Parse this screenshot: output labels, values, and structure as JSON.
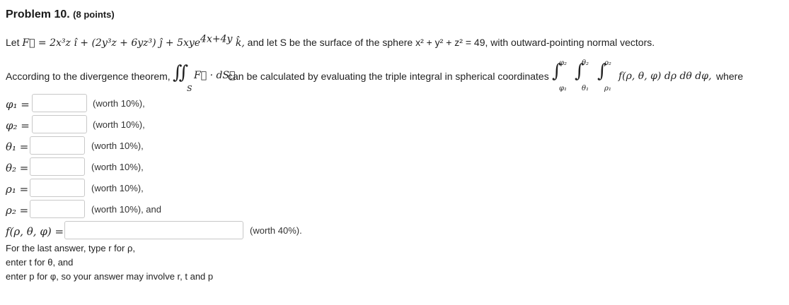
{
  "problem": {
    "title": "Problem 10.",
    "points": "(8 points)"
  },
  "statement": {
    "lead": "Let ",
    "field": "F⃗ = 2x³z î + (2y³z + 6yz³) ĵ + 5xye",
    "field_exp": "4x+4y",
    "field_tail": " k̂,",
    "surface": " and let S be the surface of the sphere x² + y² + z² = 49, with outward-pointing normal vectors."
  },
  "divergence": {
    "intro": "According to the divergence theorem,",
    "flux": "F⃗ · dS⃗",
    "surface_sub": "S",
    "middle": "can be calculated by evaluating the triple integral in spherical coordinates",
    "integrand": "f(ρ, θ, φ) dρ dθ dφ,",
    "where": "where",
    "limits": [
      "φ₂",
      "φ₁",
      "θ₂",
      "θ₁",
      "ρ₂",
      "ρ₁"
    ]
  },
  "answers": [
    {
      "label": "φ₁ =",
      "worth": "(worth 10%),",
      "value": ""
    },
    {
      "label": "φ₂ =",
      "worth": "(worth 10%),",
      "value": ""
    },
    {
      "label": "θ₁ =",
      "worth": "(worth 10%),",
      "value": ""
    },
    {
      "label": "θ₂ =",
      "worth": "(worth 10%),",
      "value": ""
    },
    {
      "label": "ρ₁ =",
      "worth": "(worth 10%),",
      "value": ""
    },
    {
      "label": "ρ₂ =",
      "worth": "(worth 10%), and",
      "value": ""
    }
  ],
  "f_answer": {
    "label": "f(ρ, θ, φ) =",
    "worth": "(worth 40%).",
    "value": ""
  },
  "instructions": [
    "For the last answer, type r for ρ,",
    "enter t for θ, and",
    "enter p for φ, so your answer may involve r, t and p"
  ]
}
